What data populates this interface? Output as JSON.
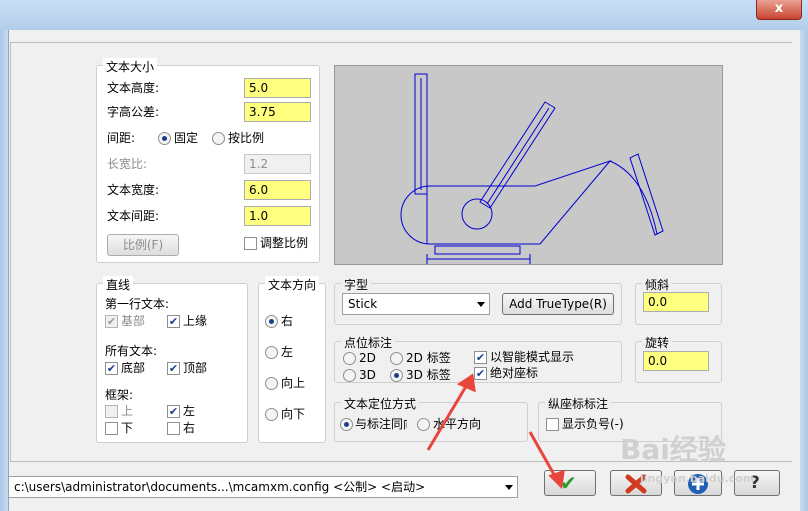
{
  "window": {
    "close_glyph": "x"
  },
  "text_size": {
    "legend": "文本大小",
    "text_height": {
      "label": "文本高度:",
      "value": "5.0"
    },
    "height_tolerance": {
      "label": "字高公差:",
      "value": "3.75"
    },
    "spacing": {
      "label": "间距:",
      "options": [
        "固定",
        "按比例"
      ],
      "selected": "固定"
    },
    "aspect_ratio": {
      "label": "长宽比:",
      "value": "1.2"
    },
    "text_width": {
      "label": "文本宽度:",
      "value": "6.0"
    },
    "text_spacing": {
      "label": "文本间距:",
      "value": "1.0"
    },
    "scale_button": "比例(F)",
    "adjust_scale": {
      "label": "调整比例",
      "checked": false
    }
  },
  "lines": {
    "legend": "直线",
    "first_line_label": "第一行文本:",
    "base": {
      "label": "基部",
      "checked": true,
      "disabled": true
    },
    "top_edge": {
      "label": "上缘",
      "checked": true
    },
    "all_text_label": "所有文本:",
    "bottom": {
      "label": "底部",
      "checked": true
    },
    "top": {
      "label": "顶部",
      "checked": true
    },
    "frame_label": "框架:",
    "frame_top": {
      "label": "上",
      "checked": false,
      "disabled": true
    },
    "frame_left": {
      "label": "左",
      "checked": true
    },
    "frame_bottom": {
      "label": "下",
      "checked": false
    },
    "frame_right": {
      "label": "右",
      "checked": false
    }
  },
  "text_direction": {
    "legend": "文本方向",
    "options": [
      "右",
      "左",
      "向上",
      "向下"
    ],
    "selected": "右"
  },
  "font": {
    "legend": "字型",
    "selected": "Stick",
    "add_truetype": "Add TrueType(R)"
  },
  "tilt": {
    "legend": "倾斜",
    "value": "0.0"
  },
  "rotation": {
    "legend": "旋转",
    "value": "0.0"
  },
  "point_label": {
    "legend": "点位标注",
    "options": [
      "2D",
      "2D 标签",
      "3D",
      "3D 标签"
    ],
    "selected": "3D 标签",
    "smart_mode": {
      "label": "以智能模式显示",
      "checked": true
    },
    "absolute_coords": {
      "label": "绝对座标",
      "checked": true
    }
  },
  "text_position": {
    "legend": "文本定位方式",
    "options": [
      "与标注同向",
      "水平方向"
    ],
    "selected": "与标注同向"
  },
  "ordinate": {
    "legend": "纵座标标注",
    "show_negative": {
      "label": "显示负号(-)",
      "checked": false
    }
  },
  "footer": {
    "config_path": "c:\\users\\administrator\\documents...\\mcamxm.config <公制> <启动>",
    "ok_glyph": "✔",
    "help_glyph": "?"
  },
  "watermark": {
    "text": "Bai经验",
    "sub": "jingyan.baidu.com"
  },
  "colors": {
    "accent_yellow": "#ffff80",
    "annotation_red": "#e8463c",
    "ok_green": "#2e9a2e",
    "preview_blue": "#0000d0"
  }
}
